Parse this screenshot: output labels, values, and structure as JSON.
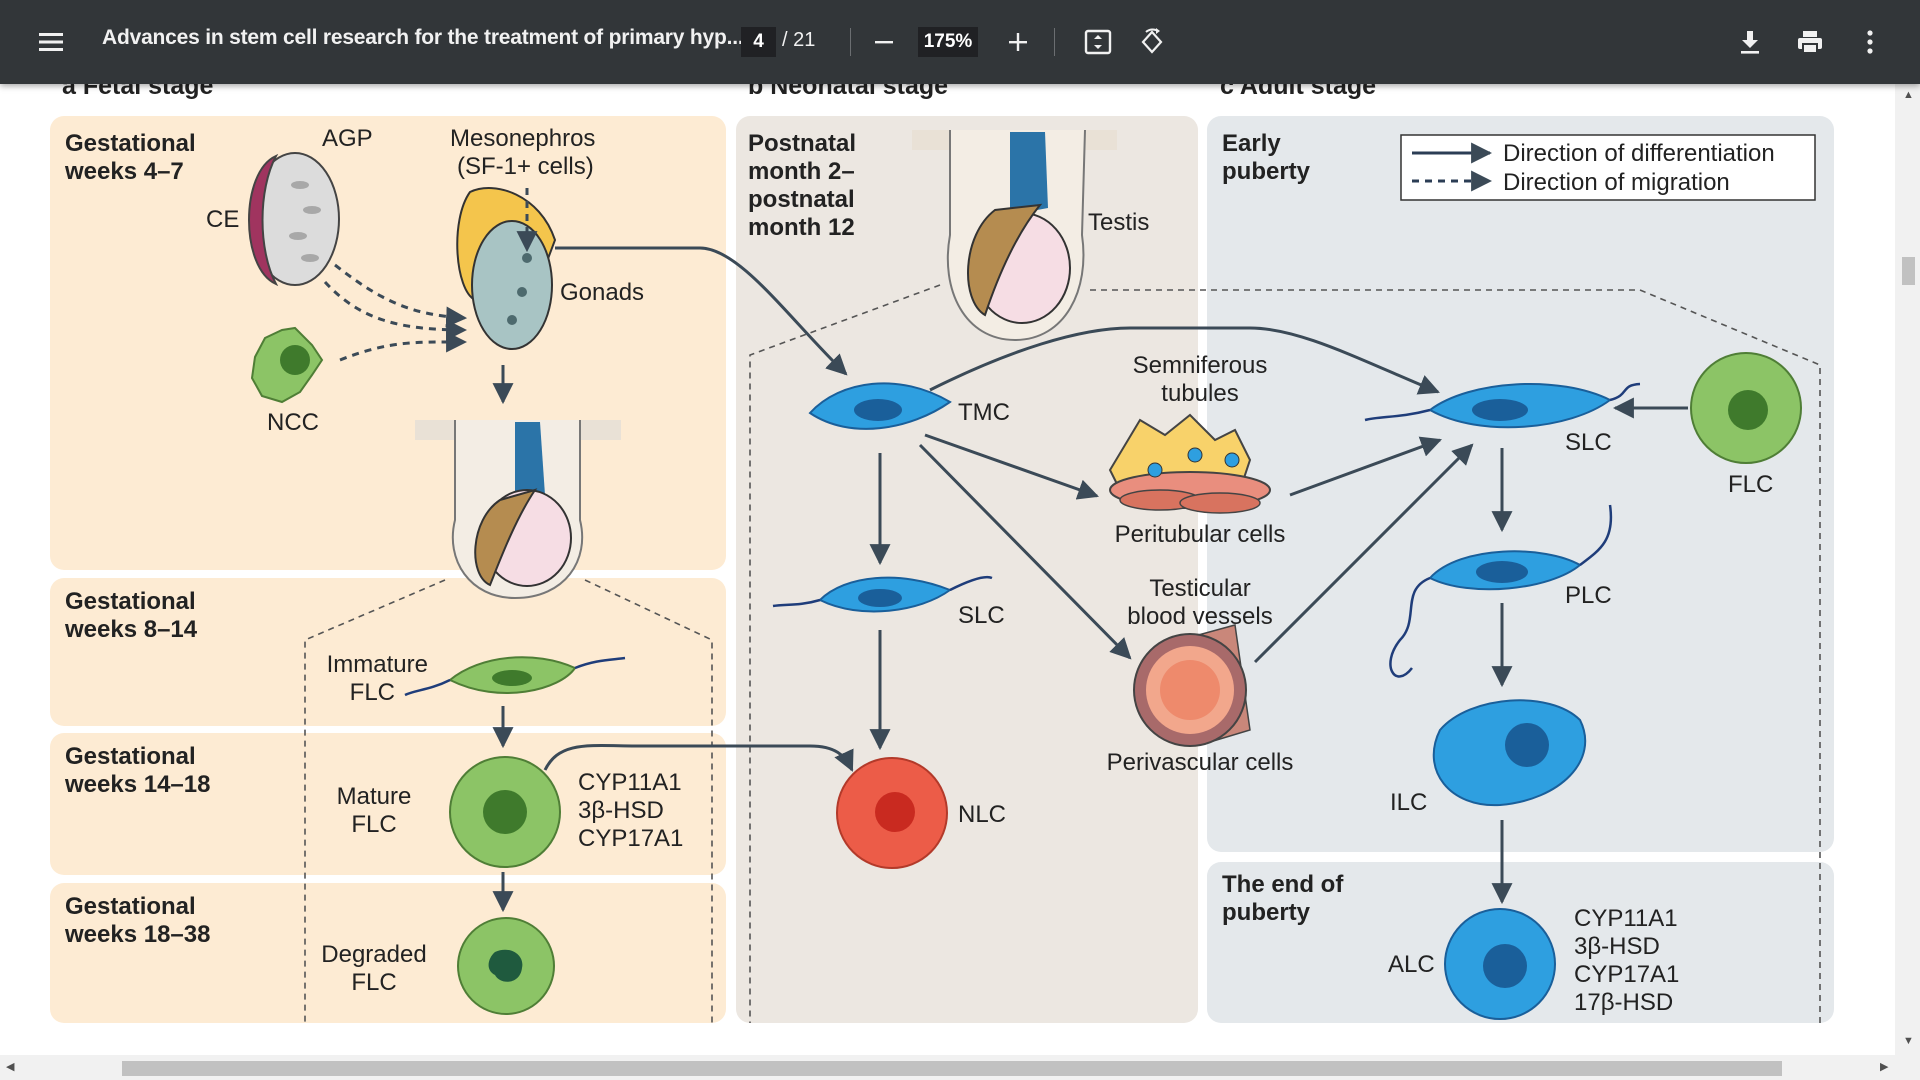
{
  "toolbar": {
    "title": "Advances in stem cell research for the treatment of primary hyp...",
    "page_current": "4",
    "page_total": "/ 21",
    "zoom": "175%",
    "icons": [
      "menu-icon",
      "zoom-out-icon",
      "zoom-in-icon",
      "fit-page-icon",
      "rotate-icon",
      "download-icon",
      "print-icon",
      "more-vert-icon"
    ]
  },
  "figure": {
    "stage_a": "a  Fetal stage",
    "stage_b": "b  Neonatal stage",
    "stage_c": "c  Adult stage",
    "gw_4_7_l1": "Gestational",
    "gw_4_7_l2": "weeks 4–7",
    "gw_8_14_l1": "Gestational",
    "gw_8_14_l2": "weeks 8–14",
    "gw_14_18_l1": "Gestational",
    "gw_14_18_l2": "weeks 14–18",
    "gw_18_38_l1": "Gestational",
    "gw_18_38_l2": "weeks 18–38",
    "agp": "AGP",
    "ce": "CE",
    "ncc": "NCC",
    "meso_l1": "Mesonephros",
    "meso_l2": "(SF-1+ cells)",
    "gonads": "Gonads",
    "immature_l1": "Immature",
    "immature_l2": "FLC",
    "mature_l1": "Mature",
    "mature_l2": "FLC",
    "enz_a_1": "CYP11A1",
    "enz_a_2": "3β-HSD",
    "enz_a_3": "CYP17A1",
    "degraded_l1": "Degraded",
    "degraded_l2": "FLC",
    "pn_l1": "Postnatal",
    "pn_l2": "month 2–",
    "pn_l3": "postnatal",
    "pn_l4": "month 12",
    "testis": "Testis",
    "tmc": "TMC",
    "slc_b": "SLC",
    "nlc": "NLC",
    "semi_l1": "Semniferous",
    "semi_l2": "tubules",
    "peritubular": "Peritubular cells",
    "vessels_l1": "Testicular",
    "vessels_l2": "blood vessels",
    "perivascular": "Perivascular cells",
    "early_l1": "Early",
    "early_l2": "puberty",
    "legend_diff": "Direction of differentiation",
    "legend_mig": "Direction of migration",
    "slc_c": "SLC",
    "flc": "FLC",
    "plc": "PLC",
    "ilc": "ILC",
    "end_l1": "The end of",
    "end_l2": "puberty",
    "alc": "ALC",
    "enz_c_1": "CYP11A1",
    "enz_c_2": "3β-HSD",
    "enz_c_3": "CYP17A1",
    "enz_c_4": "17β-HSD"
  },
  "colors": {
    "toolbar_bg": "#323639",
    "fetal_panel": "#fdebd3",
    "neonatal_panel": "#ece7e1",
    "adult_panel": "#e4e8eb",
    "cell_blue": "#2e9fe0",
    "cell_green": "#8cc466",
    "cell_red": "#ec5c48",
    "arrow": "#3b4a57"
  }
}
